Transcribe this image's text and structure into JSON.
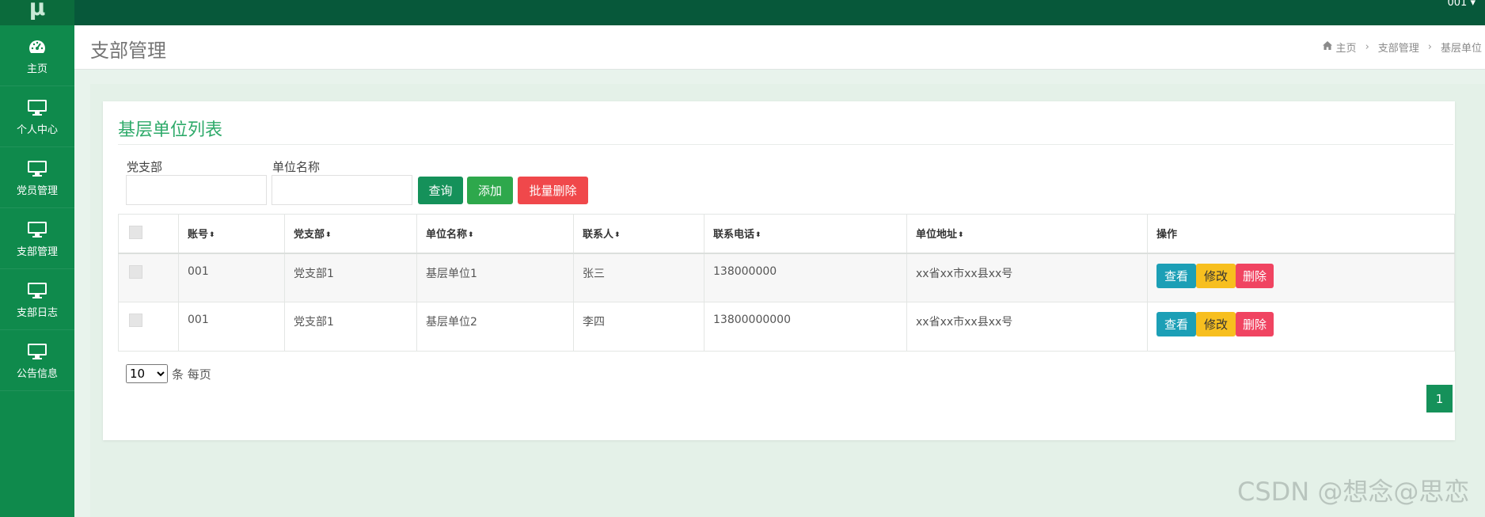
{
  "brand": {
    "logo_text": "μ"
  },
  "topbar": {
    "user": "001 ▾"
  },
  "sidebar": {
    "items": [
      {
        "label": "主页",
        "icon": "dashboard-icon"
      },
      {
        "label": "个人中心",
        "icon": "monitor-icon"
      },
      {
        "label": "党员管理",
        "icon": "monitor-icon"
      },
      {
        "label": "支部管理",
        "icon": "monitor-icon"
      },
      {
        "label": "支部日志",
        "icon": "monitor-icon"
      },
      {
        "label": "公告信息",
        "icon": "monitor-icon"
      }
    ]
  },
  "header": {
    "title": "支部管理",
    "breadcrumb": {
      "home": "主页",
      "section": "支部管理",
      "current": "基层单位"
    }
  },
  "panel": {
    "title": "基层单位列表",
    "filters": {
      "branch_label": "党支部",
      "branch_value": "",
      "unit_label": "单位名称",
      "unit_value": ""
    },
    "buttons": {
      "query": "查询",
      "add": "添加",
      "batch_delete": "批量删除"
    }
  },
  "table": {
    "columns": [
      "账号",
      "党支部",
      "单位名称",
      "联系人",
      "联系电话",
      "单位地址",
      "操作"
    ],
    "rows": [
      {
        "account": "001",
        "branch": "党支部1",
        "unit": "基层单位1",
        "contact": "张三",
        "phone": "138000000",
        "address": "xx省xx市xx县xx号"
      },
      {
        "account": "001",
        "branch": "党支部1",
        "unit": "基层单位2",
        "contact": "李四",
        "phone": "13800000000",
        "address": "xx省xx市xx县xx号"
      }
    ],
    "row_actions": {
      "view": "查看",
      "edit": "修改",
      "delete": "删除"
    }
  },
  "pagination": {
    "page_size": "10",
    "page_size_suffix": "条 每页",
    "current_page": "1"
  },
  "watermark": "CSDN @想念@思恋",
  "colors": {
    "sidebar": "#0f8a4c",
    "topbar": "#07583a",
    "accent": "#15915a",
    "title": "#2eaa6a",
    "danger": "#f0484b",
    "warning": "#f7bf1f",
    "info": "#1c9fb6"
  }
}
